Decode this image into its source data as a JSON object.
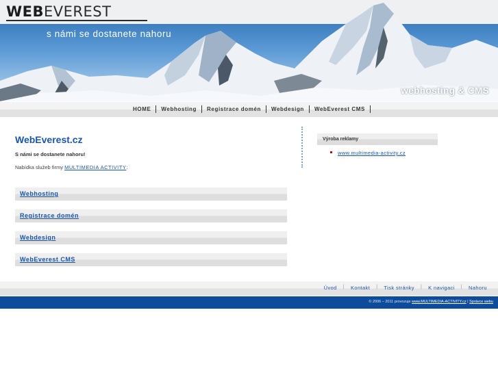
{
  "header": {
    "logo_web": "WEB",
    "logo_everest": "EVEREST",
    "slogan": "s námi se dostanete nahoru",
    "tagline": "webhosting & CMS"
  },
  "topnav": {
    "items": [
      "HOME",
      "Webhosting",
      "Registrace domén",
      "Webdesign",
      "WebEverest CMS"
    ]
  },
  "main": {
    "title": "WebEverest.cz",
    "intro": "S námi se dostanete nahoru!",
    "offer_prefix": "Nabídka služeb firmy ",
    "offer_link": "MULTIMEDIA ACTIVITY",
    "offer_suffix": ":",
    "services": [
      "Webhosting",
      "Registrace domén",
      "Webdesign",
      "WebEverest CMS"
    ]
  },
  "sidebar": {
    "heading": "Výroba reklamy",
    "links": [
      "www.multimedia-activity.cz"
    ]
  },
  "footer": {
    "nav": [
      "Úvod",
      "Kontakt",
      "Tisk stránky",
      "K navigaci",
      "Nahoru"
    ],
    "separator": "|",
    "copy_prefix": "© 2006 – 2011 provozuje ",
    "copy_link": "www.MULTIMEDIA-ACTIVITY.cz",
    "copy_sep": " | ",
    "admin_link": "Správce webu"
  },
  "colors": {
    "accent": "#1a55a7",
    "footer_bar": "#0c4c9b",
    "bullet": "#b3101e"
  }
}
